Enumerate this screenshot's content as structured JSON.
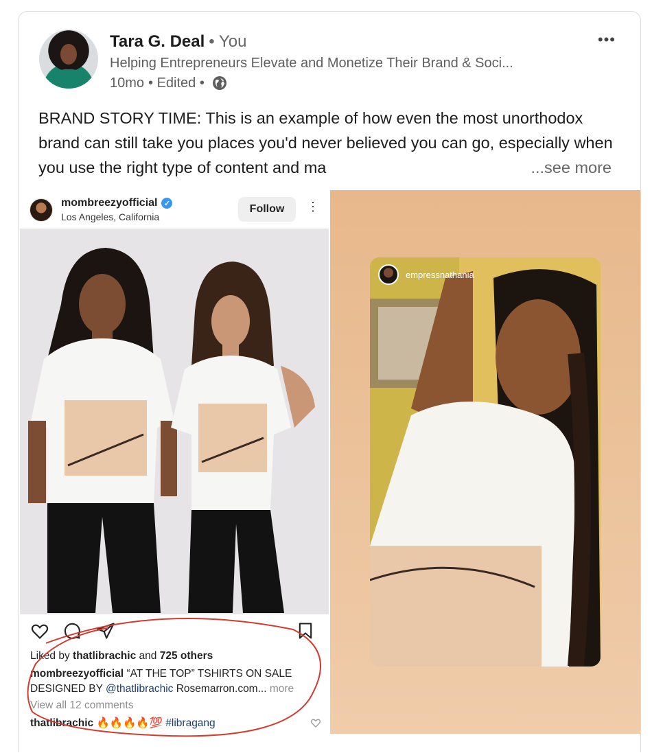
{
  "author": {
    "name": "Tara G. Deal",
    "relation": "• You",
    "headline": "Helping Entrepreneurs Elevate and Monetize Their Brand & Soci...",
    "time": "10mo",
    "edited": "• Edited •"
  },
  "post": {
    "text": "BRAND STORY TIME: This is an example of how even the most unorthodox brand can still take you places you'd never believed you can go, especially when you use the right type of content and ma",
    "see_more": "...see more",
    "more_menu": "•••"
  },
  "instagram": {
    "username": "mombreezyofficial",
    "verified_mark": "✓",
    "location": "Los Angeles, California",
    "follow_label": "Follow",
    "menu": "⋮",
    "likes_prefix": "Liked by ",
    "likes_user": "thatlibrachic",
    "likes_mid": " and ",
    "likes_count": "725 others",
    "caption_user": "mombreezyofficial",
    "caption_text": " “AT THE TOP” TSHIRTS ON SALE DESIGNED BY ",
    "caption_tag": "@thatlibrachic",
    "caption_rest": " Rosemarron.com...",
    "caption_more": " more",
    "view_comments": "View all 12 comments",
    "comment_user": "thatlibrachic",
    "comment_emoji": " 🔥🔥🔥🔥💯 ",
    "comment_tag": "#libragang",
    "icons": [
      "heart-icon",
      "comment-icon",
      "share-icon",
      "bookmark-icon"
    ]
  },
  "story": {
    "username": "empressnathania"
  }
}
